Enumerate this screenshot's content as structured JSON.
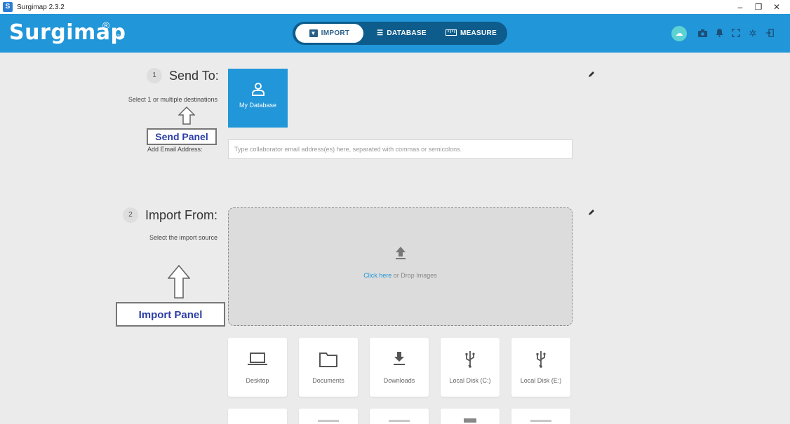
{
  "window": {
    "title": "Surgimap 2.3.2",
    "app_icon": "S",
    "minimize": "–",
    "restore": "❐",
    "close": "✕"
  },
  "header": {
    "logo": "Surgimap",
    "registered": "®",
    "version": "2.3.2",
    "nav": [
      {
        "label": "IMPORT",
        "icon": "import-icon",
        "active": true
      },
      {
        "label": "DATABASE",
        "icon": "list-icon",
        "active": false
      },
      {
        "label": "MEASURE",
        "icon": "ruler-icon",
        "active": false
      }
    ],
    "icons": [
      "cloud-sync-icon",
      "camera-icon",
      "bell-icon",
      "fullscreen-icon",
      "settings-icon",
      "logout-icon"
    ],
    "colors": {
      "bar": "#2196d9",
      "pill": "#0d5c8c",
      "cloud": "#5ed2d2"
    }
  },
  "send": {
    "number": "1",
    "title": "Send To:",
    "subtitle": "Select 1 or multiple destinations",
    "destination_label": "My Database",
    "email_label": "Add Email Address:",
    "email_placeholder": "Type collaborator email address(es) here, separated with commas or semicolons.",
    "email_value": ""
  },
  "import": {
    "number": "2",
    "title": "Import From:",
    "subtitle": "Select the import source",
    "drop_link": "Click here",
    "drop_text": " or Drop Images",
    "sources": [
      {
        "label": "Desktop",
        "icon": "laptop-icon"
      },
      {
        "label": "Documents",
        "icon": "folder-icon"
      },
      {
        "label": "Downloads",
        "icon": "download-icon"
      },
      {
        "label": "Local Disk (C:)",
        "icon": "usb-icon"
      },
      {
        "label": "Local Disk (E:)",
        "icon": "usb-icon"
      }
    ]
  },
  "annotations": {
    "send_panel": "Send Panel",
    "import_panel": "Import Panel"
  }
}
